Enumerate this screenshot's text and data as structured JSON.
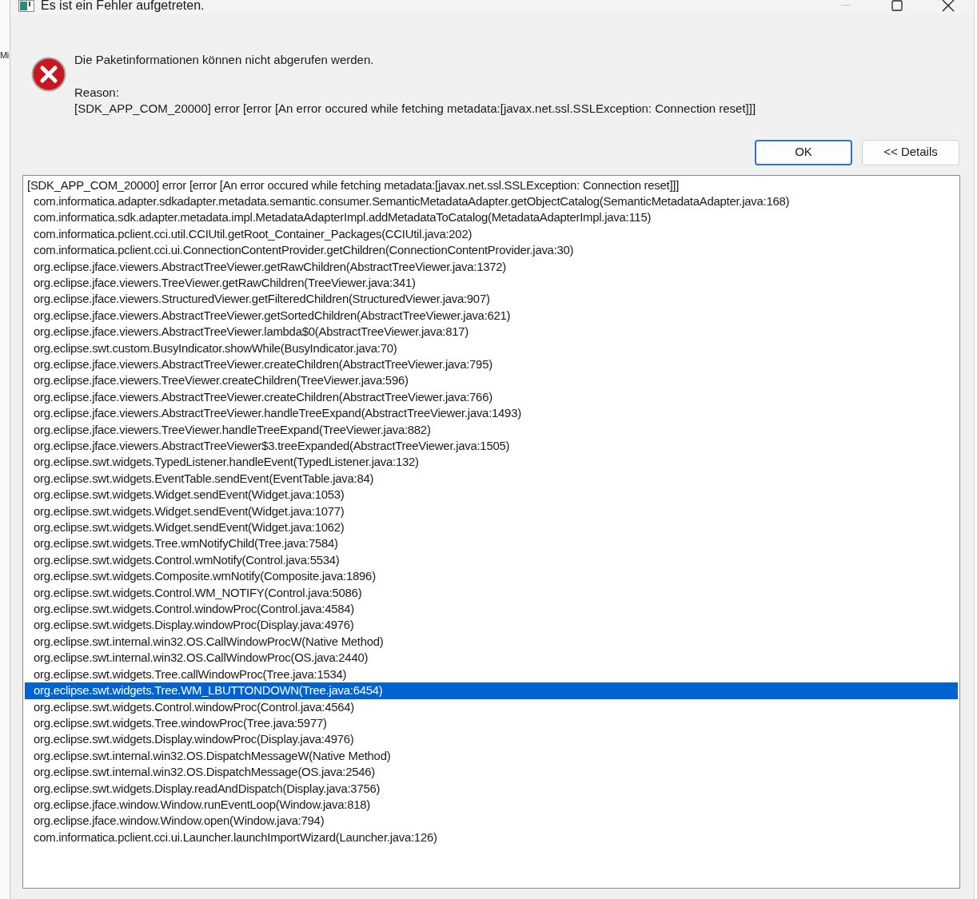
{
  "background_window": {
    "text": "Mi"
  },
  "window": {
    "title": "Es ist ein Fehler aufgetreten."
  },
  "message": {
    "headline": "Die Paketinformationen können nicht abgerufen werden.",
    "reason_label": "Reason:",
    "reason": "[SDK_APP_COM_20000] error [error [An error occured while fetching metadata:[javax.net.ssl.SSLException: Connection reset]]]"
  },
  "buttons": [
    {
      "label": "OK",
      "default": true
    },
    {
      "label": "<< Details",
      "default": false
    }
  ],
  "details": [
    {
      "kind": "message",
      "text": "[SDK_APP_COM_20000] error [error [An error occured while fetching metadata:[javax.net.ssl.SSLException: Connection reset]]]",
      "selected": false
    },
    {
      "kind": "frame",
      "text": "com.informatica.adapter.sdkadapter.metadata.semantic.consumer.SemanticMetadataAdapter.getObjectCatalog(SemanticMetadataAdapter.java:168)",
      "selected": false
    },
    {
      "kind": "frame",
      "text": "com.informatica.sdk.adapter.metadata.impl.MetadataAdapterImpl.addMetadataToCatalog(MetadataAdapterImpl.java:115)",
      "selected": false
    },
    {
      "kind": "frame",
      "text": "com.informatica.pclient.cci.util.CCIUtil.getRoot_Container_Packages(CCIUtil.java:202)",
      "selected": false
    },
    {
      "kind": "frame",
      "text": "com.informatica.pclient.cci.ui.ConnectionContentProvider.getChildren(ConnectionContentProvider.java:30)",
      "selected": false
    },
    {
      "kind": "frame",
      "text": "org.eclipse.jface.viewers.AbstractTreeViewer.getRawChildren(AbstractTreeViewer.java:1372)",
      "selected": false
    },
    {
      "kind": "frame",
      "text": "org.eclipse.jface.viewers.TreeViewer.getRawChildren(TreeViewer.java:341)",
      "selected": false
    },
    {
      "kind": "frame",
      "text": "org.eclipse.jface.viewers.StructuredViewer.getFilteredChildren(StructuredViewer.java:907)",
      "selected": false
    },
    {
      "kind": "frame",
      "text": "org.eclipse.jface.viewers.AbstractTreeViewer.getSortedChildren(AbstractTreeViewer.java:621)",
      "selected": false
    },
    {
      "kind": "frame",
      "text": "org.eclipse.jface.viewers.AbstractTreeViewer.lambda$0(AbstractTreeViewer.java:817)",
      "selected": false
    },
    {
      "kind": "frame",
      "text": "org.eclipse.swt.custom.BusyIndicator.showWhile(BusyIndicator.java:70)",
      "selected": false
    },
    {
      "kind": "frame",
      "text": "org.eclipse.jface.viewers.AbstractTreeViewer.createChildren(AbstractTreeViewer.java:795)",
      "selected": false
    },
    {
      "kind": "frame",
      "text": "org.eclipse.jface.viewers.TreeViewer.createChildren(TreeViewer.java:596)",
      "selected": false
    },
    {
      "kind": "frame",
      "text": "org.eclipse.jface.viewers.AbstractTreeViewer.createChildren(AbstractTreeViewer.java:766)",
      "selected": false
    },
    {
      "kind": "frame",
      "text": "org.eclipse.jface.viewers.AbstractTreeViewer.handleTreeExpand(AbstractTreeViewer.java:1493)",
      "selected": false
    },
    {
      "kind": "frame",
      "text": "org.eclipse.jface.viewers.TreeViewer.handleTreeExpand(TreeViewer.java:882)",
      "selected": false
    },
    {
      "kind": "frame",
      "text": "org.eclipse.jface.viewers.AbstractTreeViewer$3.treeExpanded(AbstractTreeViewer.java:1505)",
      "selected": false
    },
    {
      "kind": "frame",
      "text": "org.eclipse.swt.widgets.TypedListener.handleEvent(TypedListener.java:132)",
      "selected": false
    },
    {
      "kind": "frame",
      "text": "org.eclipse.swt.widgets.EventTable.sendEvent(EventTable.java:84)",
      "selected": false
    },
    {
      "kind": "frame",
      "text": "org.eclipse.swt.widgets.Widget.sendEvent(Widget.java:1053)",
      "selected": false
    },
    {
      "kind": "frame",
      "text": "org.eclipse.swt.widgets.Widget.sendEvent(Widget.java:1077)",
      "selected": false
    },
    {
      "kind": "frame",
      "text": "org.eclipse.swt.widgets.Widget.sendEvent(Widget.java:1062)",
      "selected": false
    },
    {
      "kind": "frame",
      "text": "org.eclipse.swt.widgets.Tree.wmNotifyChild(Tree.java:7584)",
      "selected": false
    },
    {
      "kind": "frame",
      "text": "org.eclipse.swt.widgets.Control.wmNotify(Control.java:5534)",
      "selected": false
    },
    {
      "kind": "frame",
      "text": "org.eclipse.swt.widgets.Composite.wmNotify(Composite.java:1896)",
      "selected": false
    },
    {
      "kind": "frame",
      "text": "org.eclipse.swt.widgets.Control.WM_NOTIFY(Control.java:5086)",
      "selected": false
    },
    {
      "kind": "frame",
      "text": "org.eclipse.swt.widgets.Control.windowProc(Control.java:4584)",
      "selected": false
    },
    {
      "kind": "frame",
      "text": "org.eclipse.swt.widgets.Display.windowProc(Display.java:4976)",
      "selected": false
    },
    {
      "kind": "frame",
      "text": "org.eclipse.swt.internal.win32.OS.CallWindowProcW(Native Method)",
      "selected": false
    },
    {
      "kind": "frame",
      "text": "org.eclipse.swt.internal.win32.OS.CallWindowProc(OS.java:2440)",
      "selected": false
    },
    {
      "kind": "frame",
      "text": "org.eclipse.swt.widgets.Tree.callWindowProc(Tree.java:1534)",
      "selected": false
    },
    {
      "kind": "frame",
      "text": "org.eclipse.swt.widgets.Tree.WM_LBUTTONDOWN(Tree.java:6454)",
      "selected": true
    },
    {
      "kind": "frame",
      "text": "org.eclipse.swt.widgets.Control.windowProc(Control.java:4564)",
      "selected": false
    },
    {
      "kind": "frame",
      "text": "org.eclipse.swt.widgets.Tree.windowProc(Tree.java:5977)",
      "selected": false
    },
    {
      "kind": "frame",
      "text": "org.eclipse.swt.widgets.Display.windowProc(Display.java:4976)",
      "selected": false
    },
    {
      "kind": "frame",
      "text": "org.eclipse.swt.internal.win32.OS.DispatchMessageW(Native Method)",
      "selected": false
    },
    {
      "kind": "frame",
      "text": "org.eclipse.swt.internal.win32.OS.DispatchMessage(OS.java:2546)",
      "selected": false
    },
    {
      "kind": "frame",
      "text": "org.eclipse.swt.widgets.Display.readAndDispatch(Display.java:3756)",
      "selected": false
    },
    {
      "kind": "frame",
      "text": "org.eclipse.jface.window.Window.runEventLoop(Window.java:818)",
      "selected": false
    },
    {
      "kind": "frame",
      "text": "org.eclipse.jface.window.Window.open(Window.java:794)",
      "selected": false
    },
    {
      "kind": "frame",
      "text": "com.informatica.pclient.cci.ui.Launcher.launchImportWizard(Launcher.java:126)",
      "selected": false
    }
  ]
}
